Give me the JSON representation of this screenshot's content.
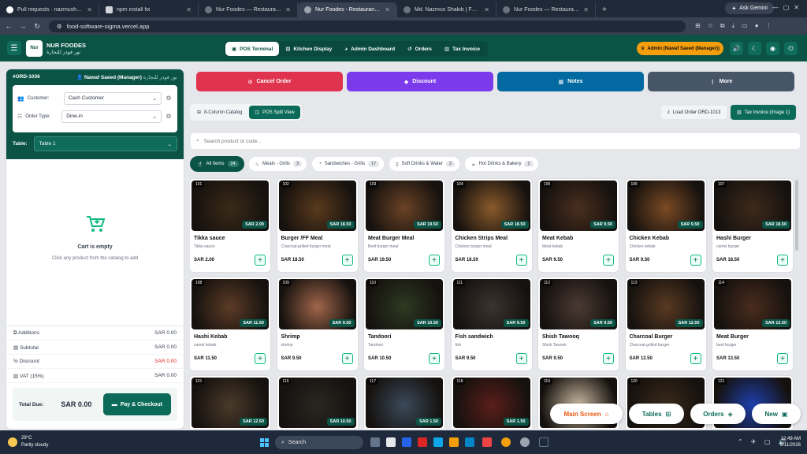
{
  "browser": {
    "tabs": [
      {
        "title": "Pull requests · nazmushakib0"
      },
      {
        "title": "npm install fix"
      },
      {
        "title": "Nur Foodes — Restaurant POS"
      },
      {
        "title": "Nur Foodes - Restaurant POS &"
      },
      {
        "title": "Md. Nazmus Shakib | Full Stack"
      },
      {
        "title": "Nur Foodes — Restaurant POS"
      }
    ],
    "gemini": "Ask Gemini",
    "url": "food-software-sigma.vercel.app"
  },
  "header": {
    "brand_name": "NUR FOODES",
    "brand_arabic": "نور فودز للتجارة",
    "logo_text": "Nur",
    "nav": [
      {
        "label": "POS Terminal"
      },
      {
        "label": "Kitchen Display"
      },
      {
        "label": "Admin Dashboard"
      },
      {
        "label": "Orders"
      },
      {
        "label": "Tax Invoice"
      }
    ],
    "admin": "Admin (Nawaf Saeed (Manager))"
  },
  "order": {
    "id": "#ORD-1036",
    "user": "Nawaf Saeed (Manager)",
    "arabic": "نور فودز للتجارة",
    "customer_label": "Customer:",
    "customer_value": "Cash Customer",
    "order_type_label": "Order Type:",
    "order_type_value": "Dine-in",
    "table_label": "Table:",
    "table_value": "Table 1",
    "empty_title": "Cart is empty",
    "empty_sub": "Click any product from the catalog to add"
  },
  "totals": [
    {
      "label": "Additions",
      "value": "SAR 0.00"
    },
    {
      "label": "Subtotal",
      "value": "SAR 0.00"
    },
    {
      "label": "Discount",
      "value": "SAR 0.00"
    },
    {
      "label": "VAT (15%)",
      "value": "SAR 0.00"
    }
  ],
  "total_due_label": "Total Due:",
  "total_due_value": "SAR 0.00",
  "pay_label": "Pay & Checkout",
  "actions": [
    {
      "label": "Cancel Order",
      "color": "#e0334d"
    },
    {
      "label": "Discount",
      "color": "#7c3aed"
    },
    {
      "label": "Notes",
      "color": "#0369a1"
    },
    {
      "label": "More",
      "color": "#475569"
    }
  ],
  "views": [
    {
      "label": "8-Column Catalog"
    },
    {
      "label": "POS Split View"
    }
  ],
  "load_order": "Load Order ORD-1013",
  "tax_invoice": "Tax Invoice (Image 1)",
  "search_placeholder": "Search product or code...",
  "categories": [
    {
      "label": "All Items",
      "count": "24"
    },
    {
      "label": "Meals - Grills",
      "count": "3"
    },
    {
      "label": "Sandwiches - Grills",
      "count": "17"
    },
    {
      "label": "Soft Drinks & Water",
      "count": "2"
    },
    {
      "label": "Hot Drinks & Bakery",
      "count": "2"
    }
  ],
  "products": [
    {
      "num": "101",
      "name": "Tikka sauce",
      "desc": "Tikka sauce",
      "price": "SAR 2.00",
      "img": "#3b2a18"
    },
    {
      "num": "102",
      "name": "Burger /FF Meal",
      "desc": "Charcoal-grilled burger meal",
      "price": "SAR 18.50",
      "img": "#5a3a1e"
    },
    {
      "num": "103",
      "name": "Meat Burger Meal",
      "desc": "Beef burger meal",
      "price": "SAR 19.50",
      "img": "#6b4326"
    },
    {
      "num": "104",
      "name": "Chicken Strips Meal",
      "desc": "Chicken burger meal",
      "price": "SAR 18.50",
      "img": "#8a5a2b"
    },
    {
      "num": "105",
      "name": "Meat Kebab",
      "desc": "Meat kebab",
      "price": "SAR 9.50",
      "img": "#4a2e1f"
    },
    {
      "num": "106",
      "name": "Chicken Kebab",
      "desc": "Chicken kebab",
      "price": "SAR 9.50",
      "img": "#7a4a24"
    },
    {
      "num": "107",
      "name": "Hashi Burger",
      "desc": "camel burger",
      "price": "SAR 18.50",
      "img": "#3e2a1c"
    },
    {
      "num": "108",
      "name": "Hashi Kebab",
      "desc": "camel kebab",
      "price": "SAR 11.50",
      "img": "#5c3b26"
    },
    {
      "num": "109",
      "name": "Shrimp",
      "desc": "shrimp",
      "price": "SAR 9.50",
      "img": "#a0664a"
    },
    {
      "num": "110",
      "name": "Tandoori",
      "desc": "Tandoori",
      "price": "SAR 10.50",
      "img": "#2d3a22"
    },
    {
      "num": "111",
      "name": "Fish sandwich",
      "desc": "fish",
      "price": "SAR 9.50",
      "img": "#3a3430"
    },
    {
      "num": "112",
      "name": "Shish Tawooq",
      "desc": "Shish Tawook",
      "price": "SAR 9.50",
      "img": "#4b3a33"
    },
    {
      "num": "113",
      "name": "Charcoal Burger",
      "desc": "Charcoal-grilled burger",
      "price": "SAR 12.50",
      "img": "#5a3a22"
    },
    {
      "num": "114",
      "name": "Meat Burger",
      "desc": "beef burger",
      "price": "SAR 13.50",
      "img": "#4a2c1e"
    },
    {
      "num": "115",
      "name": "",
      "desc": "",
      "price": "",
      "badge": "SAR 12.50",
      "img": "#4a3a2a"
    },
    {
      "num": "116",
      "name": "",
      "desc": "",
      "price": "",
      "badge": "SAR 10.50",
      "img": "#2a2622"
    },
    {
      "num": "117",
      "name": "",
      "desc": "",
      "price": "",
      "badge": "SAR 1.50",
      "img": "#3a4a5a"
    },
    {
      "num": "118",
      "name": "",
      "desc": "",
      "price": "",
      "badge": "SAR 1.50",
      "img": "#5a1e1a"
    },
    {
      "num": "119",
      "name": "",
      "desc": "",
      "price": "",
      "badge": "",
      "img": "#c9b8a0"
    },
    {
      "num": "120",
      "name": "",
      "desc": "",
      "price": "",
      "badge": "",
      "img": "#3a2a1a"
    },
    {
      "num": "121",
      "name": "",
      "desc": "",
      "price": "",
      "badge": "",
      "img": "#1e40af"
    }
  ],
  "floating": [
    {
      "label": "Main Screen",
      "color": "#ea580c"
    },
    {
      "label": "Tables",
      "color": "#0b6b58"
    },
    {
      "label": "Orders",
      "color": "#0b6b58"
    },
    {
      "label": "New",
      "color": "#0b6b58"
    }
  ],
  "taskbar": {
    "temp": "29°C",
    "weather": "Partly cloudy",
    "search": "Search",
    "time": "12:49 AM",
    "date": "9/11/2026"
  }
}
